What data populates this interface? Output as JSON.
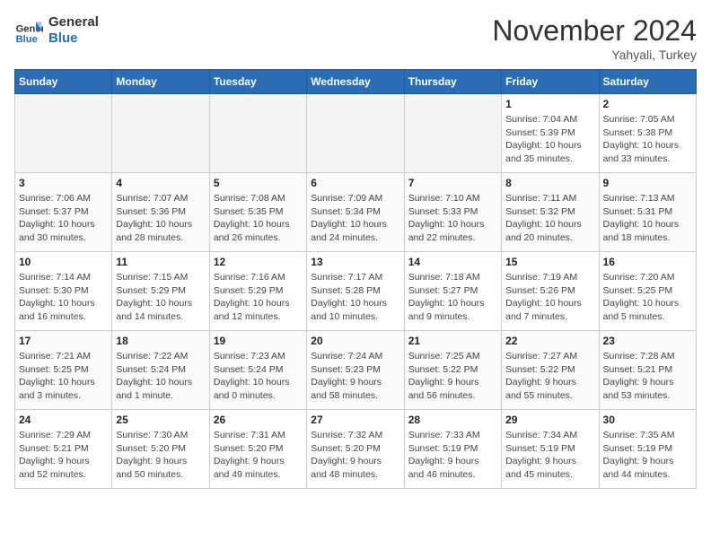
{
  "header": {
    "logo_line1": "General",
    "logo_line2": "Blue",
    "month": "November 2024",
    "location": "Yahyali, Turkey"
  },
  "days_of_week": [
    "Sunday",
    "Monday",
    "Tuesday",
    "Wednesday",
    "Thursday",
    "Friday",
    "Saturday"
  ],
  "weeks": [
    [
      {
        "day": "",
        "info": ""
      },
      {
        "day": "",
        "info": ""
      },
      {
        "day": "",
        "info": ""
      },
      {
        "day": "",
        "info": ""
      },
      {
        "day": "",
        "info": ""
      },
      {
        "day": "1",
        "info": "Sunrise: 7:04 AM\nSunset: 5:39 PM\nDaylight: 10 hours\nand 35 minutes."
      },
      {
        "day": "2",
        "info": "Sunrise: 7:05 AM\nSunset: 5:38 PM\nDaylight: 10 hours\nand 33 minutes."
      }
    ],
    [
      {
        "day": "3",
        "info": "Sunrise: 7:06 AM\nSunset: 5:37 PM\nDaylight: 10 hours\nand 30 minutes."
      },
      {
        "day": "4",
        "info": "Sunrise: 7:07 AM\nSunset: 5:36 PM\nDaylight: 10 hours\nand 28 minutes."
      },
      {
        "day": "5",
        "info": "Sunrise: 7:08 AM\nSunset: 5:35 PM\nDaylight: 10 hours\nand 26 minutes."
      },
      {
        "day": "6",
        "info": "Sunrise: 7:09 AM\nSunset: 5:34 PM\nDaylight: 10 hours\nand 24 minutes."
      },
      {
        "day": "7",
        "info": "Sunrise: 7:10 AM\nSunset: 5:33 PM\nDaylight: 10 hours\nand 22 minutes."
      },
      {
        "day": "8",
        "info": "Sunrise: 7:11 AM\nSunset: 5:32 PM\nDaylight: 10 hours\nand 20 minutes."
      },
      {
        "day": "9",
        "info": "Sunrise: 7:13 AM\nSunset: 5:31 PM\nDaylight: 10 hours\nand 18 minutes."
      }
    ],
    [
      {
        "day": "10",
        "info": "Sunrise: 7:14 AM\nSunset: 5:30 PM\nDaylight: 10 hours\nand 16 minutes."
      },
      {
        "day": "11",
        "info": "Sunrise: 7:15 AM\nSunset: 5:29 PM\nDaylight: 10 hours\nand 14 minutes."
      },
      {
        "day": "12",
        "info": "Sunrise: 7:16 AM\nSunset: 5:29 PM\nDaylight: 10 hours\nand 12 minutes."
      },
      {
        "day": "13",
        "info": "Sunrise: 7:17 AM\nSunset: 5:28 PM\nDaylight: 10 hours\nand 10 minutes."
      },
      {
        "day": "14",
        "info": "Sunrise: 7:18 AM\nSunset: 5:27 PM\nDaylight: 10 hours\nand 9 minutes."
      },
      {
        "day": "15",
        "info": "Sunrise: 7:19 AM\nSunset: 5:26 PM\nDaylight: 10 hours\nand 7 minutes."
      },
      {
        "day": "16",
        "info": "Sunrise: 7:20 AM\nSunset: 5:25 PM\nDaylight: 10 hours\nand 5 minutes."
      }
    ],
    [
      {
        "day": "17",
        "info": "Sunrise: 7:21 AM\nSunset: 5:25 PM\nDaylight: 10 hours\nand 3 minutes."
      },
      {
        "day": "18",
        "info": "Sunrise: 7:22 AM\nSunset: 5:24 PM\nDaylight: 10 hours\nand 1 minute."
      },
      {
        "day": "19",
        "info": "Sunrise: 7:23 AM\nSunset: 5:24 PM\nDaylight: 10 hours\nand 0 minutes."
      },
      {
        "day": "20",
        "info": "Sunrise: 7:24 AM\nSunset: 5:23 PM\nDaylight: 9 hours\nand 58 minutes."
      },
      {
        "day": "21",
        "info": "Sunrise: 7:25 AM\nSunset: 5:22 PM\nDaylight: 9 hours\nand 56 minutes."
      },
      {
        "day": "22",
        "info": "Sunrise: 7:27 AM\nSunset: 5:22 PM\nDaylight: 9 hours\nand 55 minutes."
      },
      {
        "day": "23",
        "info": "Sunrise: 7:28 AM\nSunset: 5:21 PM\nDaylight: 9 hours\nand 53 minutes."
      }
    ],
    [
      {
        "day": "24",
        "info": "Sunrise: 7:29 AM\nSunset: 5:21 PM\nDaylight: 9 hours\nand 52 minutes."
      },
      {
        "day": "25",
        "info": "Sunrise: 7:30 AM\nSunset: 5:20 PM\nDaylight: 9 hours\nand 50 minutes."
      },
      {
        "day": "26",
        "info": "Sunrise: 7:31 AM\nSunset: 5:20 PM\nDaylight: 9 hours\nand 49 minutes."
      },
      {
        "day": "27",
        "info": "Sunrise: 7:32 AM\nSunset: 5:20 PM\nDaylight: 9 hours\nand 48 minutes."
      },
      {
        "day": "28",
        "info": "Sunrise: 7:33 AM\nSunset: 5:19 PM\nDaylight: 9 hours\nand 46 minutes."
      },
      {
        "day": "29",
        "info": "Sunrise: 7:34 AM\nSunset: 5:19 PM\nDaylight: 9 hours\nand 45 minutes."
      },
      {
        "day": "30",
        "info": "Sunrise: 7:35 AM\nSunset: 5:19 PM\nDaylight: 9 hours\nand 44 minutes."
      }
    ]
  ]
}
